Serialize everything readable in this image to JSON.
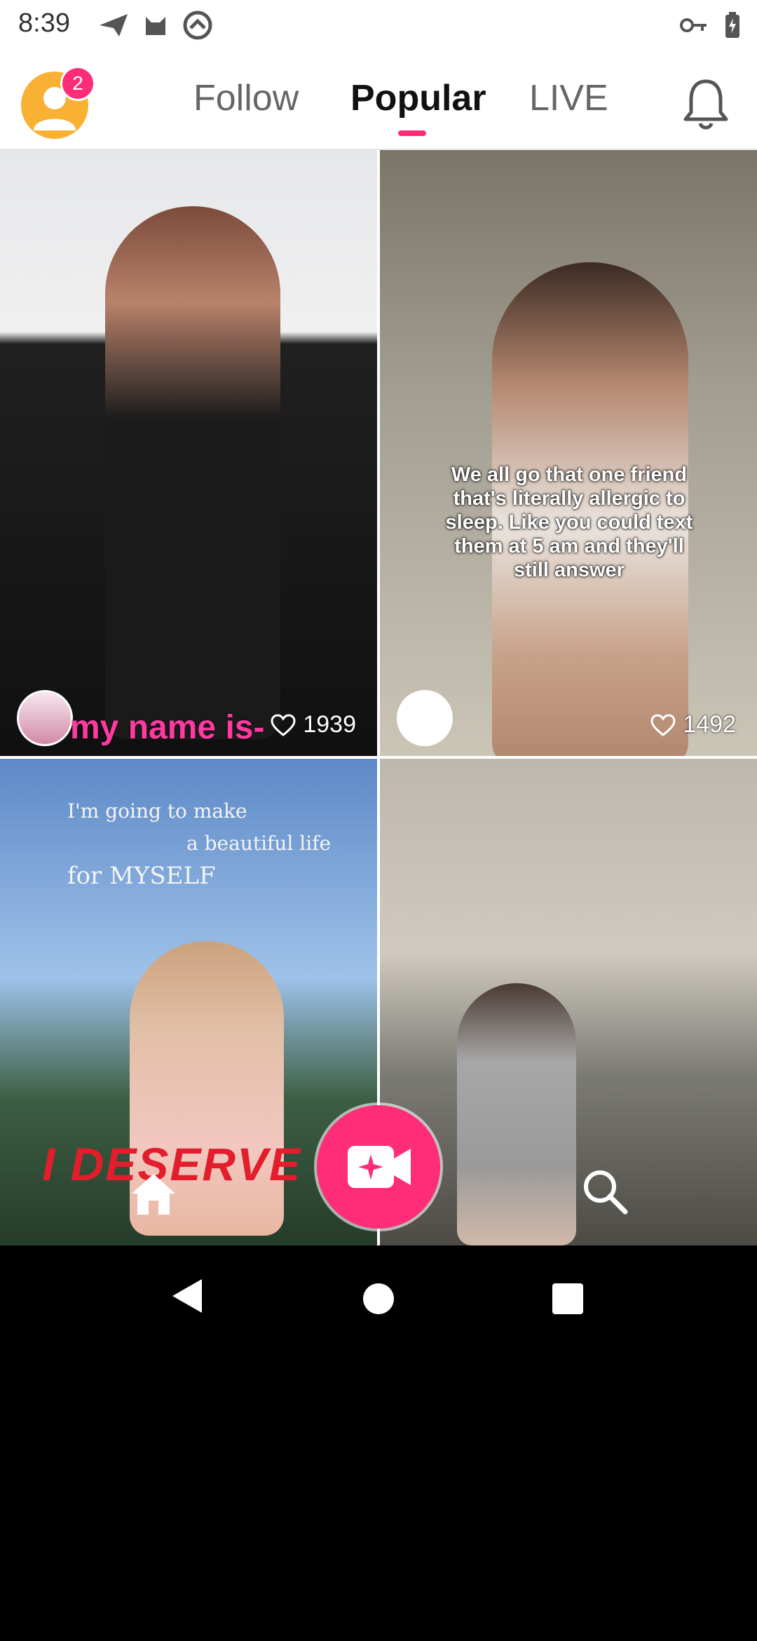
{
  "status_bar": {
    "time": "8:39",
    "left_icons": [
      "paper-plane-icon",
      "cat-icon",
      "at-sign-icon"
    ],
    "right_icons": [
      "key-icon",
      "battery-charging-icon"
    ]
  },
  "header": {
    "notification_badge": "2",
    "tabs": [
      {
        "label": "Follow",
        "active": false
      },
      {
        "label": "Popular",
        "active": true
      },
      {
        "label": "LIVE",
        "active": false
      }
    ],
    "accent_color": "#ff2c78"
  },
  "feed": {
    "cards": [
      {
        "caption": "my name is-",
        "likes": "1939"
      },
      {
        "overlay_text": "We all go that one friend that's literally allergic to sleep. Like you could text them at 5 am and they'll still answer",
        "likes": "1492"
      },
      {
        "overlay_lines": [
          "I'm going to make",
          "a beautiful life",
          "for MYSELF"
        ],
        "overlay_bottom": "I DESERVE I"
      },
      {}
    ]
  },
  "bottom_bar": {
    "icons": [
      "home-icon",
      "video-camera-sparkle-icon",
      "search-icon"
    ]
  },
  "android_nav": {
    "icons": [
      "back-icon",
      "home-circle-icon",
      "recents-square-icon"
    ]
  }
}
